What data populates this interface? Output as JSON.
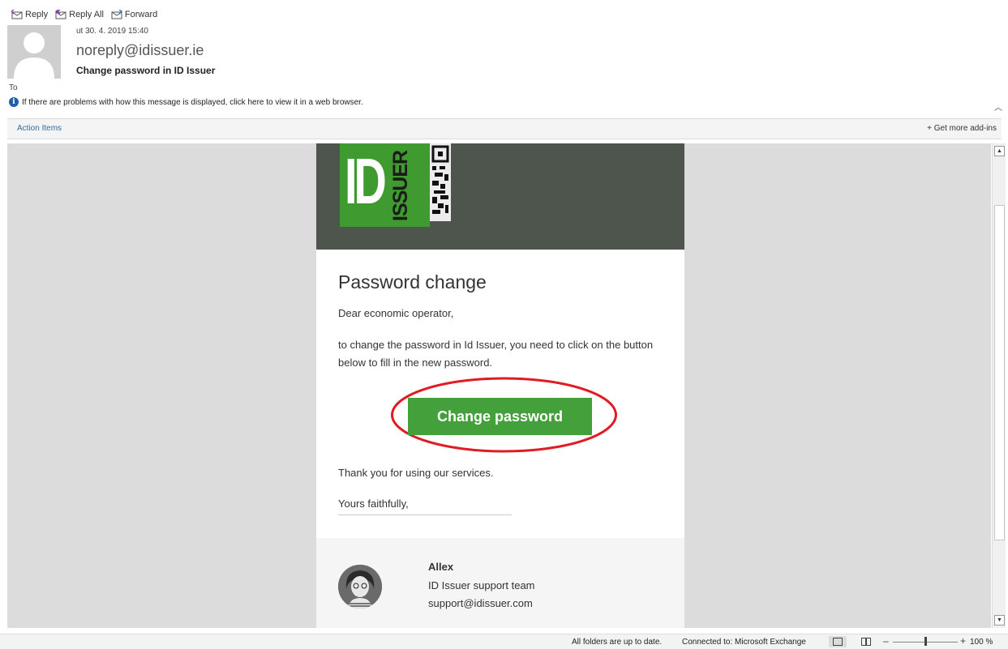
{
  "toolbar": {
    "reply_label": "Reply",
    "reply_all_label": "Reply All",
    "forward_label": "Forward"
  },
  "message": {
    "date": "ut 30. 4. 2019 15:40",
    "sender": "noreply@idissuer.ie",
    "subject": "Change password in ID Issuer",
    "to_label": "To",
    "info_text": "If there are problems with how this message is displayed, click here to view it in a web browser."
  },
  "actionbar": {
    "action_items": "Action Items",
    "get_addins": "Get more add-ins"
  },
  "email": {
    "logo_id": "ID",
    "logo_issuer": "ISSUER",
    "title": "Password change",
    "greeting": "Dear economic operator,",
    "body": "to change the password in Id Issuer, you need to click on the button below to fill in the new password.",
    "cta_label": "Change password",
    "thanks": "Thank you for using our services.",
    "closing": "Yours faithfully,",
    "footer_name": "Allex",
    "footer_team": "ID Issuer support team",
    "footer_email": "support@idissuer.com"
  },
  "statusbar": {
    "sync_status": "All folders are up to date.",
    "connection": "Connected to: Microsoft Exchange",
    "zoom": "100 %"
  },
  "colors": {
    "brand_green": "#43a03a",
    "banner": "#4e554d",
    "annotation_red": "#e01b24",
    "link_blue": "#2e6da4"
  }
}
